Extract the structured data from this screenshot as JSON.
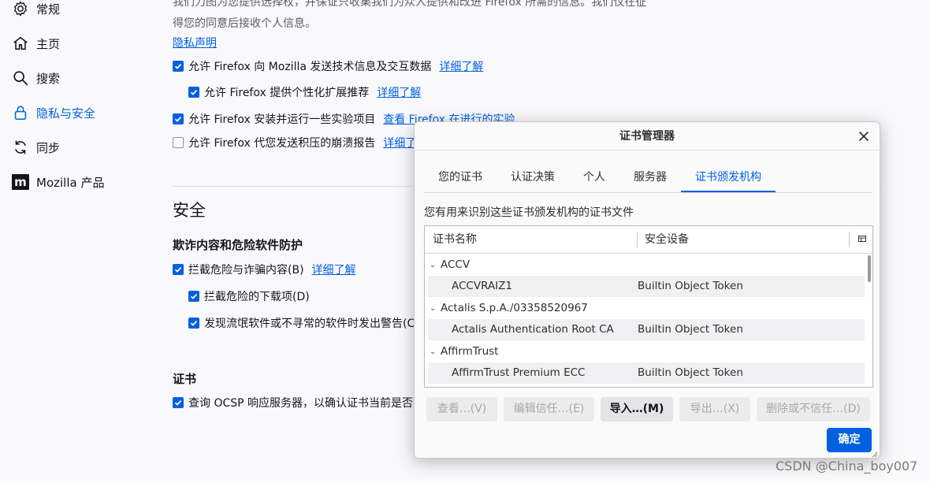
{
  "sidebar": {
    "items": [
      {
        "label": "常规",
        "icon": "gear-icon"
      },
      {
        "label": "主页",
        "icon": "home-icon"
      },
      {
        "label": "搜索",
        "icon": "search-icon"
      },
      {
        "label": "隐私与安全",
        "icon": "lock-icon",
        "active": true
      },
      {
        "label": "同步",
        "icon": "sync-icon"
      },
      {
        "label": "Mozilla 产品",
        "icon": "mozilla-logo-icon",
        "logo_text": "m"
      }
    ]
  },
  "main": {
    "intro_line1": "我们力图为您提供选择权，并保证只收集我们为众人提供和改进 Firefox 所需的信息。我们仅在征",
    "intro_line2": "得您的同意后接收个人信息。",
    "privacy_link": "隐私声明",
    "telemetry": [
      {
        "label": "允许 Firefox 向 Mozilla 发送技术信息及交互数据",
        "link": "详细了解",
        "checked": true
      },
      {
        "label": "允许 Firefox 提供个性化扩展推荐",
        "link": "详细了解",
        "checked": true
      },
      {
        "label": "允许 Firefox 安装并运行一些实验项目",
        "link": "查看 Firefox 在进行的实验",
        "checked": true
      },
      {
        "label": "允许 Firefox 代您发送积压的崩溃报告",
        "link": "详细了解",
        "checked": false
      }
    ],
    "security_heading": "安全",
    "fraud_heading": "欺诈内容和危险软件防护",
    "fraud": [
      {
        "label": "拦截危险与诈骗内容(B)",
        "link": "详细了解",
        "checked": true
      },
      {
        "label": "拦截危险的下载项(D)",
        "checked": true
      },
      {
        "label": "发现流氓软件或不寻常的软件时发出警告(C)",
        "checked": true
      }
    ],
    "cert_heading": "证书",
    "ocsp_label": "查询 OCSP 响应服务器，以确认证书当前是否有效"
  },
  "dialog": {
    "title": "证书管理器",
    "tabs": [
      "您的证书",
      "认证决策",
      "个人",
      "服务器",
      "证书颁发机构"
    ],
    "active_tab": 4,
    "description": "您有用来识别这些证书颁发机构的证书文件",
    "columns": [
      "证书名称",
      "安全设备"
    ],
    "rows": [
      {
        "group": "ACCV"
      },
      {
        "name": "ACCVRAIZ1",
        "device": "Builtin Object Token"
      },
      {
        "group": "Actalis S.p.A./03358520967"
      },
      {
        "name": "Actalis Authentication Root CA",
        "device": "Builtin Object Token"
      },
      {
        "group": "AffirmTrust"
      },
      {
        "name": "AffirmTrust Premium ECC",
        "device": "Builtin Object Token"
      }
    ],
    "buttons": {
      "view": "查看…(V)",
      "edit": "编辑信任…(E)",
      "import": "导入…(M)",
      "export": "导出…(X)",
      "delete": "删除或不信任…(D)"
    },
    "ok": "确定"
  },
  "watermark": "CSDN @China_boy007",
  "colors": {
    "accent": "#0061e0",
    "text": "#15141a",
    "background": "#f9f9fb"
  }
}
